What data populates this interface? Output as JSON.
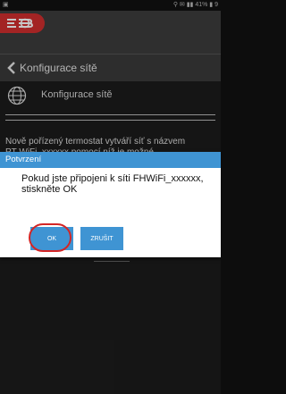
{
  "status_bar": {
    "left_icon": "gallery-icon",
    "right_text": "⚲ ✉ ▮▮ 41% ▮ 9"
  },
  "app_logo": "brand-logo",
  "header": {
    "back_icon": "chevron-left-icon",
    "title": "Konfigurace sítě"
  },
  "menu": {
    "icon": "globe-icon",
    "label": "Konfigurace sítě"
  },
  "background_text": [
    "Nově pořízený termostat vytváří síť s názvem",
    "PT WiFi_xxxxxx pomocí níž je možné"
  ],
  "dialog": {
    "title": "Potvrzení",
    "message": "Pokud jste připojeni k síti FHWiFi_xxxxxx, stiskněte OK",
    "ok_label": "OK",
    "cancel_label": "ZRUŠIT"
  },
  "colors": {
    "accent": "#3f94d3",
    "brand_red": "#d12f2f",
    "highlight": "#d32626"
  }
}
